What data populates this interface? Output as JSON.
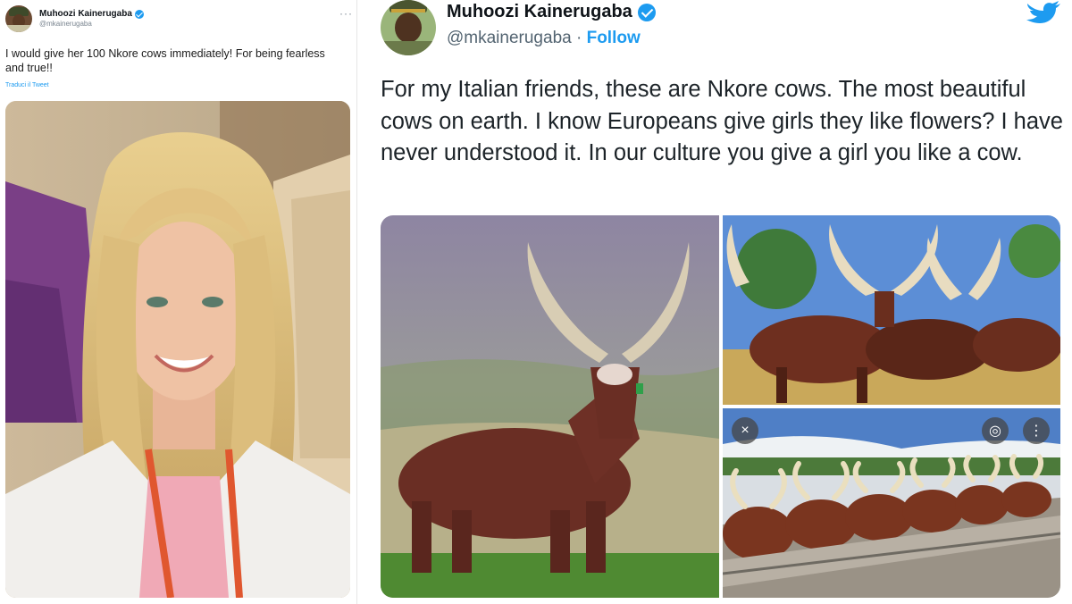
{
  "left_tweet": {
    "author_name": "Muhoozi Kainerugaba",
    "author_handle": "@mkainerugaba",
    "more_label": "···",
    "text": "I would give her 100 Nkore cows immediately! For being fearless and true!!",
    "translate_label": "Traduci il Tweet",
    "photo_icon": "portrait-photo"
  },
  "right_tweet": {
    "author_name": "Muhoozi Kainerugaba",
    "author_handle": "@mkainerugaba",
    "separator": "·",
    "follow_label": "Follow",
    "text": "For my Italian friends, these are Nkore cows. The most beautiful cows on earth. I know Europeans give girls they like flowers? I have never understood it. In our culture you give a girl you like a cow.",
    "images": [
      "nkore-cow-single",
      "nkore-cows-herd",
      "nkore-cows-drinking"
    ],
    "overlay_buttons": {
      "close": "×",
      "lens": "◎",
      "more": "⋮"
    }
  },
  "colors": {
    "accent": "#1d9bf0",
    "text": "#0f1419",
    "secondary": "#536471"
  },
  "icons": [
    "verified-badge-icon",
    "twitter-bird-icon",
    "close-icon",
    "lens-icon",
    "more-vertical-icon"
  ]
}
